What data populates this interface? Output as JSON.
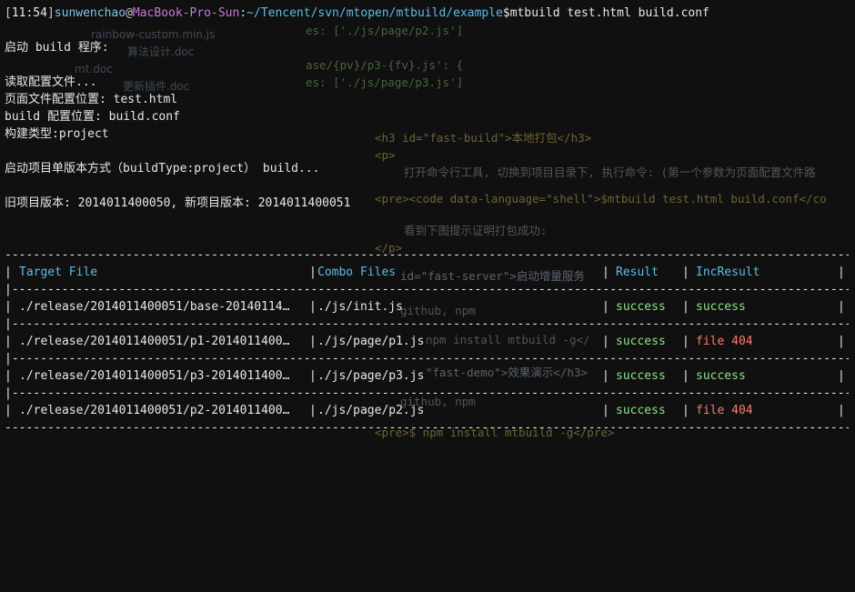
{
  "prompt": {
    "time": "11:54",
    "user": "sunwenchao",
    "host": "MacBook-Pro-Sun",
    "path": "~/Tencent/svn/mtopen/mtbuild/example",
    "command": "$mtbuild test.html build.conf"
  },
  "output": {
    "start": "启动 build 程序:",
    "reading": "读取配置文件...",
    "page_conf": "页面文件配置位置: test.html",
    "build_conf": "build 配置位置: build.conf",
    "build_type": "构建类型:project",
    "single_mode": "启动项目单版本方式（buildType:project） build...",
    "versions": "旧项目版本: 2014011400050, 新项目版本: 2014011400051"
  },
  "table": {
    "headers": [
      "Target File",
      "Combo Files",
      "Result",
      "IncResult"
    ],
    "rows": [
      {
        "target": "./release/2014011400051/base-20140114…",
        "combo": "./js/init.js",
        "result": "success",
        "inc": "success",
        "inc_status": "ok"
      },
      {
        "target": "./release/2014011400051/p1-2014011400…",
        "combo": "./js/page/p1.js",
        "result": "success",
        "inc": "file 404",
        "inc_status": "err"
      },
      {
        "target": "./release/2014011400051/p3-2014011400…",
        "combo": "./js/page/p3.js",
        "result": "success",
        "inc": "success",
        "inc_status": "ok"
      },
      {
        "target": "./release/2014011400051/p2-2014011400…",
        "combo": "./js/page/p2.js",
        "result": "success",
        "inc": "file 404",
        "inc_status": "err"
      }
    ]
  },
  "background": {
    "files": [
      "rainbow-custom.min.js",
      "算法设计.doc",
      "mt.doc",
      "更新插件.doc"
    ],
    "code": [
      "es: ['./js/page/p2.js']",
      "ase/{pv}/p3-{fv}.js': {",
      "es: ['./js/page/p3.js']",
      "<h3 id=\"fast-build\">本地打包</h3>",
      "<p>",
      "打开命令行工具, 切换到项目目录下, 执行命令: (第一个参数为页面配置文件路",
      "<pre><code data-language=\"shell\">$mtbuild test.html build.conf</co",
      "看到下图提示证明打包成功:",
      "</p>",
      "id=\"fast-server\">启动增量服务",
      "github, npm",
      "npm install mtbuild -g</",
      "\"fast-demo\">效果演示</h3>",
      "github, npm",
      "<pre>$ npm install mtbuild -g</pre>"
    ]
  }
}
